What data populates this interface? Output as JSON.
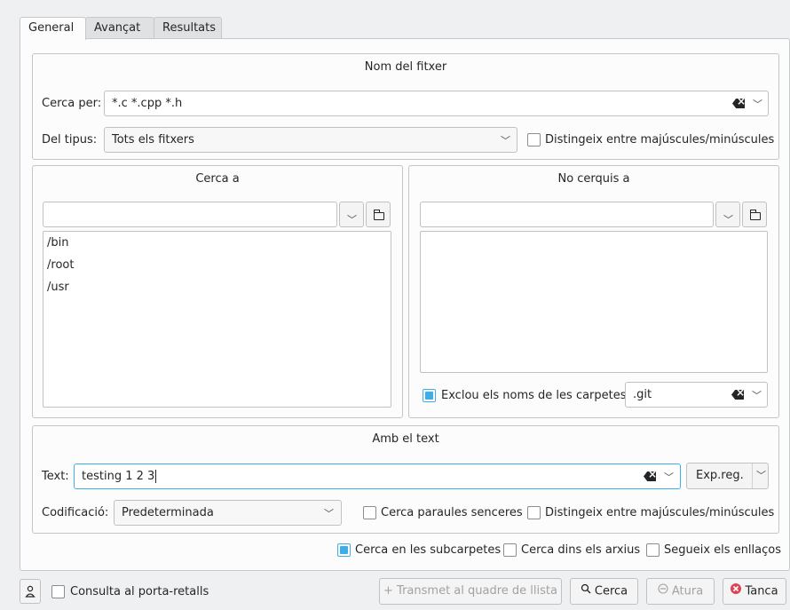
{
  "tabs": [
    {
      "label": "General",
      "active": true
    },
    {
      "label": "Avançat",
      "active": false
    },
    {
      "label": "Resultats",
      "active": false
    }
  ],
  "filename_group": {
    "title": "Nom del fitxer",
    "search_by_label": "Cerca per:",
    "search_by_value": "*.c *.cpp *.h",
    "type_label": "Del tipus:",
    "type_value": "Tots els fitxers",
    "case_sensitive_label": "Distingeix entre majúscules/minúscules",
    "case_sensitive_checked": false
  },
  "search_in": {
    "title": "Cerca a",
    "input_value": "",
    "items": [
      "/bin",
      "/root",
      "/usr"
    ]
  },
  "dont_search_in": {
    "title": "No cerquis a",
    "input_value": "",
    "items": [],
    "exclude_label": "Exclou els noms de les carpetes",
    "exclude_checked": true,
    "exclude_value": ".git"
  },
  "text_group": {
    "title": "Amb el text",
    "text_label": "Text:",
    "text_value": "testing 1 2 3",
    "regex_label": "Exp.reg.",
    "encoding_label": "Codificació:",
    "encoding_value": "Predeterminada",
    "whole_words_label": "Cerca paraules senceres",
    "whole_words_checked": false,
    "case_sensitive_label": "Distingeix entre majúscules/minúscules",
    "case_sensitive_checked": false
  },
  "options": {
    "subfolders_label": "Cerca en les subcarpetes",
    "subfolders_checked": true,
    "archives_label": "Cerca dins els arxius",
    "archives_checked": false,
    "symlinks_label": "Segueix els enllaços",
    "symlinks_checked": false
  },
  "footer": {
    "clipboard_label": "Consulta al porta-retalls",
    "clipboard_checked": false,
    "feed_button": "+ Transmet al quadre de llista",
    "search_button": "Cerca",
    "stop_button": "Atura",
    "close_button": "Tanca"
  },
  "colors": {
    "accent": "#3daee9",
    "close_icon": "#da4453"
  }
}
